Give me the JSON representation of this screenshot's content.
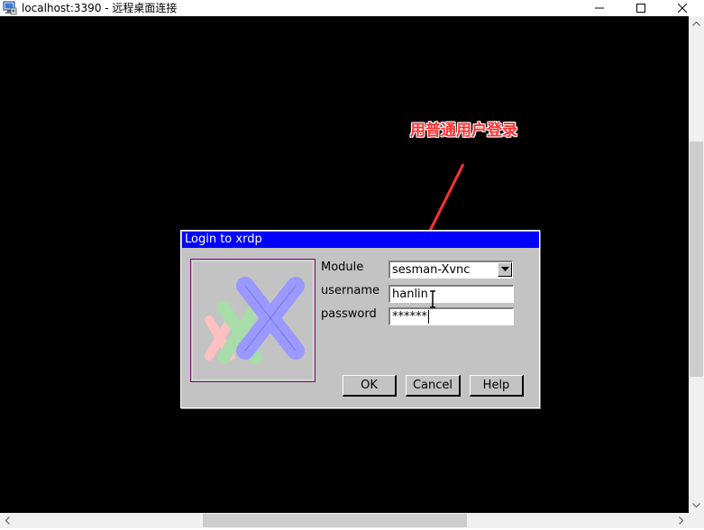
{
  "window": {
    "title": "localhost:3390 - 远程桌面连接",
    "icon": "remote-desktop-icon",
    "controls": [
      "minimize-icon",
      "maximize-icon",
      "close-icon"
    ]
  },
  "annotation": {
    "text": "用普通用户登录",
    "color": "#ff3030"
  },
  "dialog": {
    "title": "Login to xrdp",
    "title_bar_color": "#0000ff",
    "logo": "xrdp-logo-icon",
    "module_label": "Module",
    "module_value": "sesman-Xvnc",
    "username_label": "username",
    "username_value": "hanlin",
    "password_label": "password",
    "password_value": "******",
    "buttons": {
      "ok": "OK",
      "cancel": "Cancel",
      "help": "Help"
    }
  }
}
